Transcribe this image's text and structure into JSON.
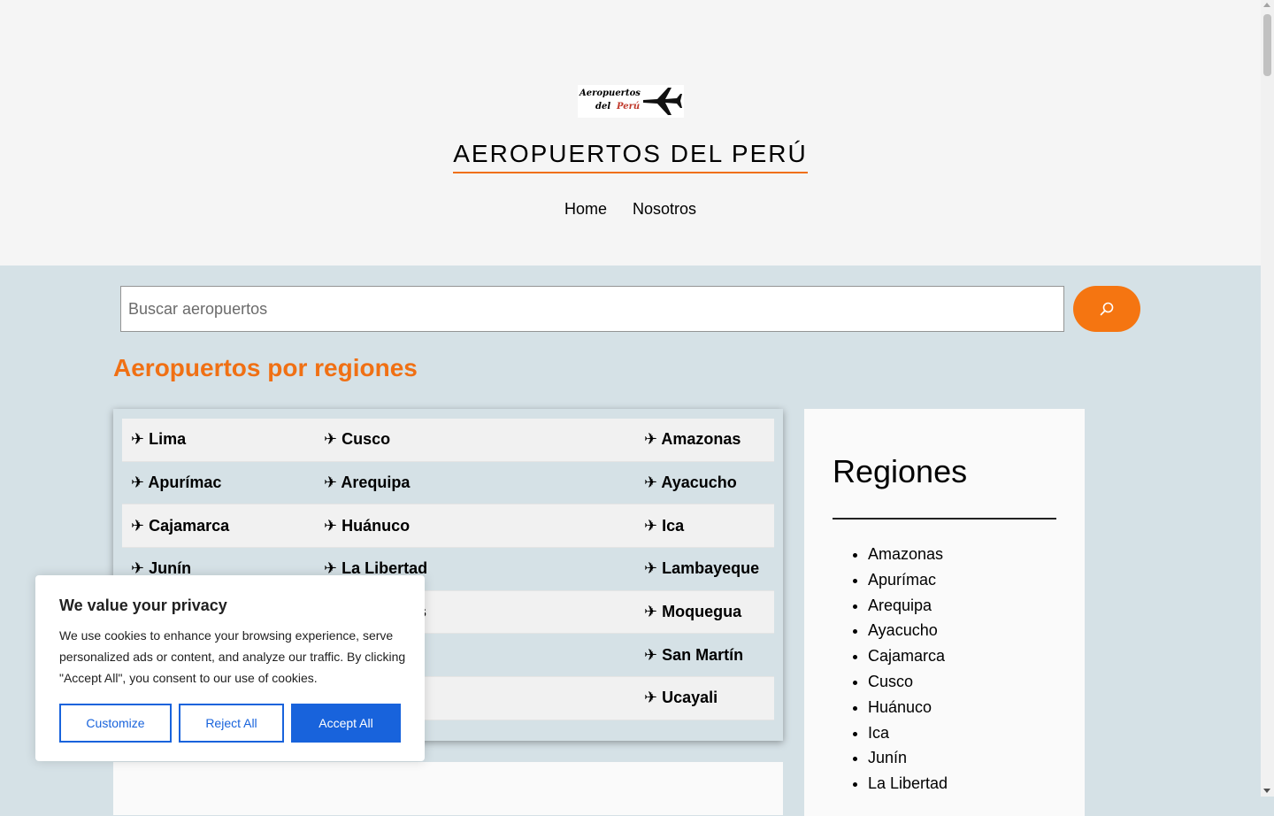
{
  "header": {
    "logo": {
      "line1": "Aeropuertos",
      "line2": "del",
      "line3": "Perú",
      "icon": "airplane-icon"
    },
    "site_title": "AEROPUERTOS DEL PERÚ",
    "accent_color": "#f07014",
    "nav": [
      "Home",
      "Nosotros"
    ]
  },
  "search": {
    "placeholder": "Buscar aeropuertos",
    "button_icon": "search-icon",
    "button_color": "#f57511"
  },
  "main": {
    "section_title": "Aeropuertos por regiones",
    "region_rows": [
      [
        "✈ Lima",
        "✈ Cusco",
        "✈ Amazonas"
      ],
      [
        "✈ Apurímac",
        "✈ Arequipa",
        "✈ Ayacucho"
      ],
      [
        "✈ Cajamarca",
        "✈ Huánuco",
        "✈ Ica"
      ],
      [
        "✈ Junín",
        "✈ La Libertad",
        "✈ Lambayeque"
      ],
      [
        "",
        "ios",
        "✈ Moquegua"
      ],
      [
        "",
        "",
        "✈ San Martín"
      ],
      [
        "",
        "",
        "✈ Ucayali"
      ]
    ]
  },
  "sidebar": {
    "title": "Regiones",
    "items": [
      "Amazonas",
      "Apurímac",
      "Arequipa",
      "Ayacucho",
      "Cajamarca",
      "Cusco",
      "Huánuco",
      "Ica",
      "Junín",
      "La Libertad"
    ]
  },
  "cookie": {
    "title": "We value your privacy",
    "text": "We use cookies to enhance your browsing experience, serve personalized ads or content, and analyze our traffic. By clicking \"Accept All\", you consent to our use of cookies.",
    "customize_label": "Customize",
    "reject_label": "Reject All",
    "accept_label": "Accept All",
    "accent_color": "#1863dc"
  }
}
